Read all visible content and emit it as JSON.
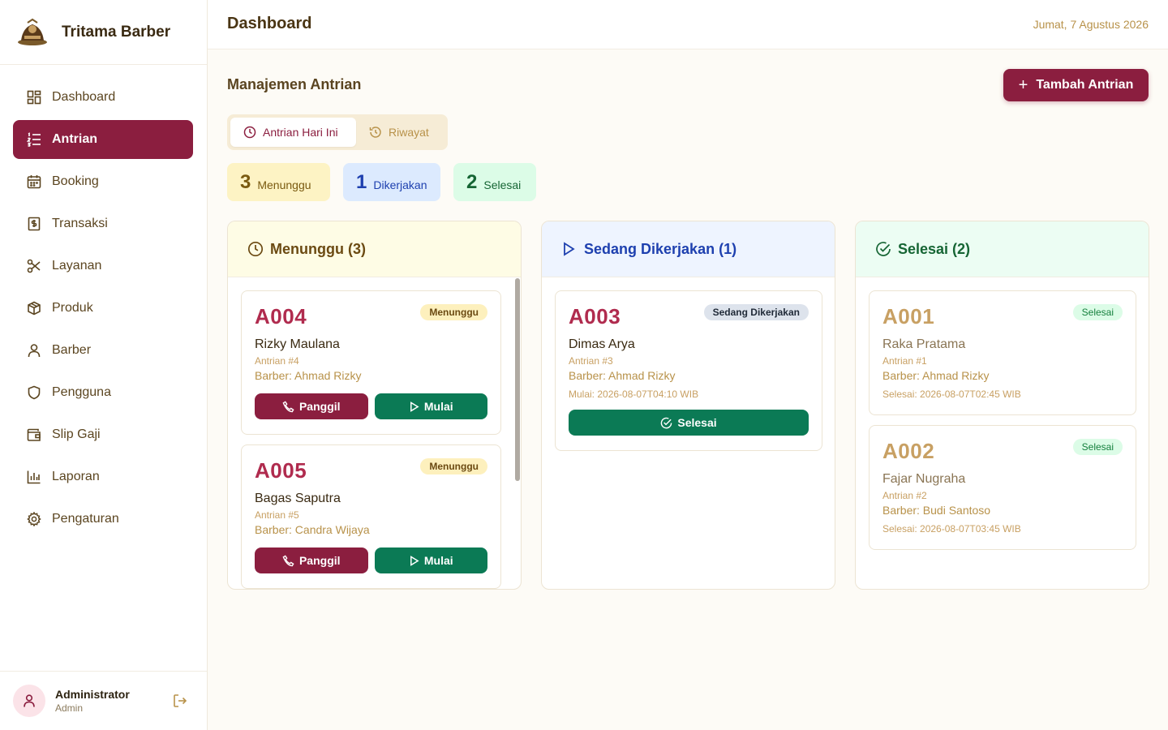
{
  "brand": {
    "name": "Tritama Barber"
  },
  "sidebar": {
    "items": [
      {
        "label": "Dashboard",
        "icon": "grid-icon"
      },
      {
        "label": "Antrian",
        "icon": "list-numbered-icon",
        "active": true
      },
      {
        "label": "Booking",
        "icon": "calendar-icon"
      },
      {
        "label": "Transaksi",
        "icon": "receipt-icon"
      },
      {
        "label": "Layanan",
        "icon": "scissors-icon"
      },
      {
        "label": "Produk",
        "icon": "package-icon"
      },
      {
        "label": "Barber",
        "icon": "user-icon"
      },
      {
        "label": "Pengguna",
        "icon": "shield-icon"
      },
      {
        "label": "Slip Gaji",
        "icon": "wallet-icon"
      },
      {
        "label": "Laporan",
        "icon": "bar-chart-icon"
      },
      {
        "label": "Pengaturan",
        "icon": "gear-icon"
      }
    ]
  },
  "user": {
    "name": "Administrator",
    "role": "Admin"
  },
  "header": {
    "title": "Dashboard",
    "date": "Jumat, 7 Agustus 2026"
  },
  "main": {
    "section_title": "Manajemen Antrian",
    "add_button": "Tambah Antrian",
    "tabs": [
      {
        "label": "Antrian Hari Ini",
        "active": true
      },
      {
        "label": "Riwayat",
        "active": false
      }
    ],
    "stats": [
      {
        "count": "3",
        "label": "Menunggu"
      },
      {
        "count": "1",
        "label": "Dikerjakan"
      },
      {
        "count": "2",
        "label": "Selesai"
      }
    ],
    "columns": {
      "waiting": {
        "title": "Menunggu (3)",
        "cards": [
          {
            "code": "A004",
            "badge": "Menunggu",
            "name": "Rizky Maulana",
            "queue": "Antrian #4",
            "barber": "Barber: Ahmad Rizky",
            "call": "Panggil",
            "start": "Mulai"
          },
          {
            "code": "A005",
            "badge": "Menunggu",
            "name": "Bagas Saputra",
            "queue": "Antrian #5",
            "barber": "Barber: Candra Wijaya",
            "call": "Panggil",
            "start": "Mulai"
          }
        ]
      },
      "working": {
        "title": "Sedang Dikerjakan (1)",
        "cards": [
          {
            "code": "A003",
            "badge": "Sedang Dikerjakan",
            "name": "Dimas Arya",
            "queue": "Antrian #3",
            "barber": "Barber: Ahmad Rizky",
            "meta": "Mulai: 2026-08-07T04:10 WIB",
            "finish": "Selesai"
          }
        ]
      },
      "done": {
        "title": "Selesai (2)",
        "cards": [
          {
            "code": "A001",
            "badge": "Selesai",
            "name": "Raka Pratama",
            "queue": "Antrian #1",
            "barber": "Barber: Ahmad Rizky",
            "meta": "Selesai: 2026-08-07T02:45 WIB"
          },
          {
            "code": "A002",
            "badge": "Selesai",
            "name": "Fajar Nugraha",
            "queue": "Antrian #2",
            "barber": "Barber: Budi Santoso",
            "meta": "Selesai: 2026-08-07T03:45 WIB"
          }
        ]
      }
    }
  },
  "colors": {
    "primary": "#8b1e3f",
    "success": "#0b7a55",
    "accent": "#b8924a"
  }
}
